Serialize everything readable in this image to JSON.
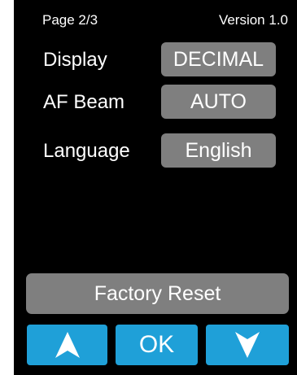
{
  "header": {
    "page": "Page 2/3",
    "version": "Version 1.0"
  },
  "settings": [
    {
      "label": "Display",
      "value": "DECIMAL"
    },
    {
      "label": "AF Beam",
      "value": "AUTO"
    },
    {
      "label": "Language",
      "value": "English"
    }
  ],
  "actions": {
    "factory_reset": "Factory Reset",
    "ok": "OK",
    "up_icon": "arrow-up-icon",
    "down_icon": "arrow-down-icon"
  },
  "colors": {
    "background": "#000000",
    "button_gray": "#7f7f7f",
    "nav_blue": "#1fa0d8",
    "text": "#ffffff"
  }
}
